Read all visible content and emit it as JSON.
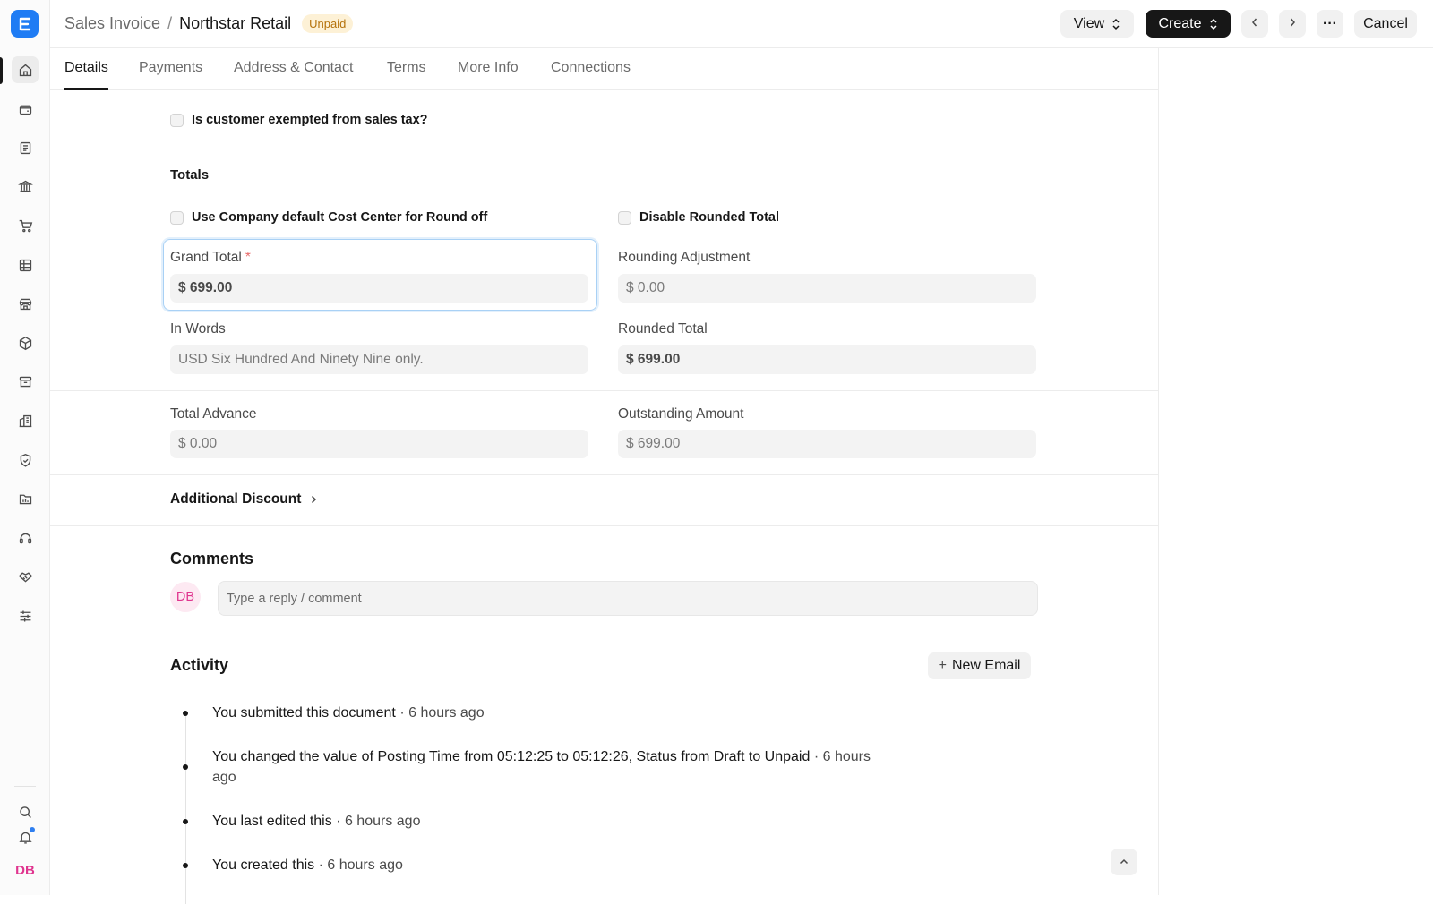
{
  "header": {
    "breadcrumb_parent": "Sales Invoice",
    "breadcrumb_separator": "/",
    "title": "Northstar Retail",
    "status": "Unpaid",
    "view_label": "View",
    "create_label": "Create",
    "cancel_label": "Cancel",
    "more_label": "···"
  },
  "tabs": [
    "Details",
    "Payments",
    "Address & Contact",
    "Terms",
    "More Info",
    "Connections"
  ],
  "form": {
    "tax_exempt_label": "Is customer exempted from sales tax?",
    "totals_title": "Totals",
    "use_company_cc_label": "Use Company default Cost Center for Round off",
    "disable_rounded_label": "Disable Rounded Total",
    "grand_total_label": "Grand Total",
    "required_mark": "*",
    "grand_total_value": "$ 699.00",
    "rounding_adjustment_label": "Rounding Adjustment",
    "rounding_adjustment_value": "$ 0.00",
    "in_words_label": "In Words",
    "in_words_value": "USD Six Hundred And Ninety Nine only.",
    "rounded_total_label": "Rounded Total",
    "rounded_total_value": "$ 699.00",
    "total_advance_label": "Total Advance",
    "total_advance_value": "$ 0.00",
    "outstanding_label": "Outstanding Amount",
    "outstanding_value": "$ 699.00",
    "additional_discount_label": "Additional Discount"
  },
  "comments": {
    "title": "Comments",
    "avatar_initials": "DB",
    "placeholder": "Type a reply / comment"
  },
  "activity": {
    "title": "Activity",
    "new_email_label": "New Email",
    "items": [
      {
        "parts": [
          "You submitted this document",
          " · 6 hours ago"
        ]
      },
      {
        "parts": [
          "You changed the value of Posting Time from ",
          "05:12:25",
          " to ",
          "05:12:26",
          ", Status from ",
          "Draft",
          " to ",
          "Unpaid",
          " · 6 hours ago"
        ]
      },
      {
        "parts": [
          "You last edited this",
          " · 6 hours ago"
        ]
      },
      {
        "parts": [
          "You created this",
          " · 6 hours ago"
        ]
      }
    ]
  },
  "sidebar": {
    "user_initials": "DB",
    "items": [
      "home-icon",
      "wallet-icon",
      "document-icon",
      "bank-icon",
      "cart-icon",
      "table-icon",
      "store-icon",
      "box-icon",
      "archive-icon",
      "building-icon",
      "shield-icon",
      "folder-chart-icon",
      "headset-icon",
      "handshake-icon",
      "sliders-icon"
    ]
  },
  "colors": {
    "brand": "#1f7cf4",
    "status_unpaid_bg": "#fdf1d6",
    "status_unpaid_text": "#b5720b",
    "focus_border": "#a9d1f5",
    "avatar_pink": "#e0358f"
  }
}
